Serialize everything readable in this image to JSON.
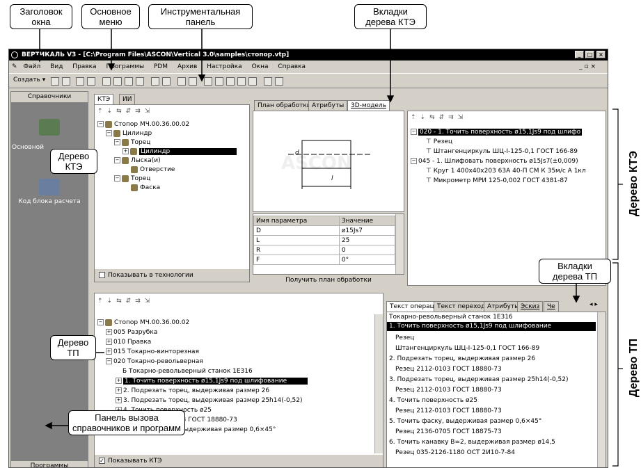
{
  "callouts": {
    "title": "Заголовок\nокна",
    "menu": "Основное\nменю",
    "toolbar": "Инструментальная\nпанель",
    "ktetabs": "Вкладки\nдерева КТЭ",
    "ktetree": "Дерево\nКТЭ",
    "tptree": "Дерево\nТП",
    "tptabs": "Вкладки\nдерева ТП",
    "callpanel": "Панель вызова\nсправочников и программ"
  },
  "side": {
    "kte": "Дерево КТЭ",
    "tp": "Дерево ТП"
  },
  "window": {
    "title": "ВЕРТИКАЛЬ V3 - [C:\\Program Files\\ASCON\\Vertical 3.0\\samples\\стопор.vtp]"
  },
  "menu": [
    "Файл",
    "Вид",
    "Правка",
    "Программы",
    "PDM",
    "Архив",
    "Настройка",
    "Окна",
    "Справка"
  ],
  "toolbar": {
    "create": "Создать"
  },
  "left": {
    "header": "Справочники",
    "item1": "Основной",
    "item2": "Код блока расчета",
    "bottom": "Программы"
  },
  "kte": {
    "tabs": [
      "КТЭ",
      "ИИ"
    ],
    "tree": [
      "Стопор МЧ.00.36.00.02",
      "Цилиндр",
      "Торец",
      "Цилиндр",
      "Лыска(и)",
      "Отверстие",
      "Торец",
      "Фаска"
    ],
    "show": "Показывать в технологии"
  },
  "center": {
    "tabs": [
      "План обработки",
      "Атрибуты",
      "3D-модель"
    ],
    "grid_head": [
      "Имя параметра",
      "Значение"
    ],
    "grid": [
      [
        "D",
        "ø15Js7"
      ],
      [
        "L",
        "25"
      ],
      [
        "R",
        "0"
      ],
      [
        "F",
        "0°"
      ]
    ],
    "button": "Получить план обработки",
    "drawing_d": "d",
    "drawing_l": "l",
    "watermark": "ASCON"
  },
  "plan": {
    "rows": [
      "020 - 1. Точить поверхность ø15,1Js9 под шлифо",
      "Резец",
      "Штангенциркуль ШЦ-I-125-0,1  ГОСТ 166-89",
      "045 - 1. Шлифовать поверхность  ø15Js7(±0,009)",
      "Круг 1 400х40х203 63А 40-П СМ К 35м/с А 1кл",
      "Микрометр МРИ 125-0,002 ГОСТ 4381-87"
    ]
  },
  "tp": {
    "tree": [
      "Стопор МЧ.00.36.00.02",
      "005 Разрубка",
      "010 Правка",
      "015 Токарно-винторезная",
      "020 Токарно-револьверная",
      "Токарно-револьверный станок 1Е316",
      "1. Точить поверхность ø15,1Js9 под шлифование",
      "2. Подрезать торец, выдерживая размер 26",
      "3. Подрезать торец, выдерживая размер 25h14(-0,52)",
      "4. Точить поверхность ø25",
      "Резец 2112-0103 ГОСТ 18880-73",
      "5. Точить фаску, выдерживая размер 0,6×45°"
    ],
    "show": "Показывать КТЭ"
  },
  "optabs": [
    "Текст операции",
    "Текст перехода",
    "Атрибуты",
    "Эскиз",
    "Че"
  ],
  "optext": [
    "Токарно-револьверный станок 1Е316",
    "1. Точить поверхность ø15,1Js9 под шлифование",
    "Резец",
    "Штангенциркуль ШЦ-I-125-0,1 ГОСТ 166-89",
    "2. Подрезать торец, выдерживая размер 26",
    "Резец 2112-0103 ГОСТ 18880-73",
    "3. Подрезать торец, выдерживая размер 25h14(-0,52)",
    "Резец 2112-0103 ГОСТ 18880-73",
    "4. Точить поверхность ø25",
    "Резец 2112-0103 ГОСТ 18880-73",
    "5. Точить фаску, выдерживая размер 0,6×45°",
    "Резец 2136-0705 ГОСТ 18875-73",
    "6. Точить канавку В=2, выдерживая размер ø14,5",
    "Резец 035-2126-1180 ОСТ 2И10-7-84"
  ]
}
